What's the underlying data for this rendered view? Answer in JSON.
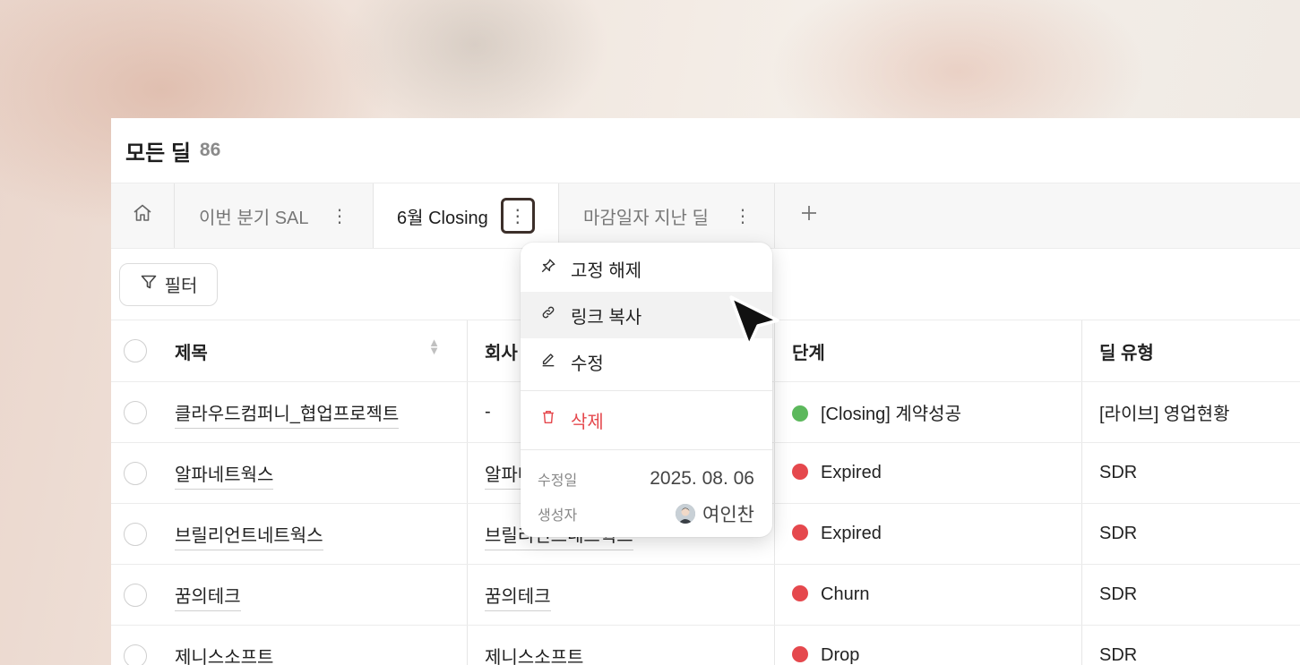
{
  "header": {
    "title": "모든 딜",
    "count": "86"
  },
  "tabs": [
    {
      "label": "이번 분기 SAL"
    },
    {
      "label": "6월 Closing"
    },
    {
      "label": "마감일자 지난 딜"
    }
  ],
  "toolbar": {
    "filter_label": "필터"
  },
  "table": {
    "columns": [
      "제목",
      "회사",
      "단계",
      "딜 유형"
    ],
    "rows": [
      {
        "title": "클라우드컴퍼니_협업프로젝트",
        "company": "-",
        "stage": "[Closing] 계약성공",
        "stage_color": "#5cb85c",
        "type": "[라이브] 영업현황"
      },
      {
        "title": "알파네트웍스",
        "company": "알파네트웍스",
        "stage": "Expired",
        "stage_color": "#e5484d",
        "type": "SDR"
      },
      {
        "title": "브릴리언트네트웍스",
        "company": "브릴리언트네트웍스",
        "stage": "Expired",
        "stage_color": "#e5484d",
        "type": "SDR"
      },
      {
        "title": "꿈의테크",
        "company": "꿈의테크",
        "stage": "Churn",
        "stage_color": "#e5484d",
        "type": "SDR"
      },
      {
        "title": "제니스소프트",
        "company": "제니스소프트",
        "stage": "Drop",
        "stage_color": "#e5484d",
        "type": "SDR"
      }
    ]
  },
  "menu": {
    "unpin": "고정 해제",
    "copy_link": "링크 복사",
    "edit": "수정",
    "delete": "삭제",
    "modified_label": "수정일",
    "modified_value": "2025. 08. 06",
    "creator_label": "생성자",
    "creator_value": "여인찬"
  }
}
